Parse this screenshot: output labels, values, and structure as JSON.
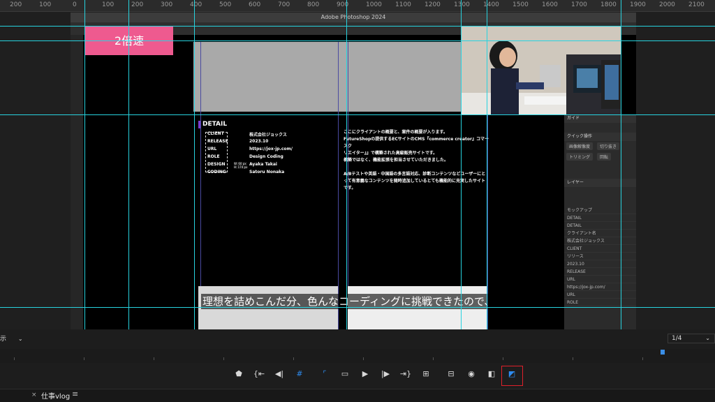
{
  "app": {
    "title": "Adobe Photoshop 2024"
  },
  "ruler": {
    "labels": [
      "200",
      "100",
      "0",
      "100",
      "200",
      "300",
      "400",
      "500",
      "600",
      "700",
      "800",
      "900",
      "1000",
      "1100",
      "1200",
      "1300",
      "1400",
      "1500",
      "1600",
      "1700",
      "1800",
      "1900",
      "2000",
      "2100"
    ]
  },
  "overlay": {
    "speed_label": "2倍速",
    "subtitle": "理想を詰めこんだ分、色んなコーディングに挑戦できたので、"
  },
  "detail": {
    "title": "DETAIL",
    "rows": [
      {
        "label": "CLIENT",
        "value": "株式会社ジョックス"
      },
      {
        "label": "RELEASE",
        "value": "2023.10"
      },
      {
        "label": "URL",
        "value": "https://jox-jp.com/"
      },
      {
        "label": "ROLE",
        "value": "Design Coding"
      },
      {
        "label": "DESIGN",
        "value": "Ayaka Takai"
      },
      {
        "label": "CODING",
        "value": "Satoru Nonaka"
      }
    ],
    "dim_w": "W: 60 px",
    "dim_h": "H: 174 px",
    "description": [
      "ここにクライアントの概要と、案件の概要が入ります。",
      "FutureShopの提供するECサイトのCMS『commerce creator』コマースク",
      "リエイター』』で構築された高級販売サイトです。",
      "構築ではなく、機能拡張を担当させていただきました。",
      "",
      "A/Bテストや英語・中国語の多言語対応、診断コンテンツなどユーザーにと",
      "って有意義なコンテンツを随時追加しているとても機能的に充実したサイト",
      "です。"
    ]
  },
  "ps_panel": {
    "guide_header": "ガイド",
    "quick_header": "クイック操作",
    "quick_buttons": [
      "画像解像度",
      "切り抜き",
      "トリミング",
      "回転"
    ],
    "layers_header": "レイヤー",
    "layers": [
      "モックアップ",
      "DETAIL",
      "DETAIL",
      "クライアント名",
      "株式会社ジョックス",
      "CLIENT",
      "リリース",
      "2023.10",
      "RELEASE",
      "URL",
      "https://jox-jp.com/",
      "URL",
      "ROLE"
    ]
  },
  "player": {
    "view_label": "示",
    "zoom": "1/4",
    "sequence_title": "仕事vlog",
    "menu_icon": "≡"
  },
  "controls": [
    {
      "name": "add-marker-icon",
      "glyph": "⬟"
    },
    {
      "name": "mark-in-icon",
      "glyph": "{⇤"
    },
    {
      "name": "step-back-icon",
      "glyph": "◀|"
    },
    {
      "name": "guides-icon",
      "glyph": "#"
    },
    {
      "name": "safe-margin-icon",
      "glyph": "⌜"
    },
    {
      "name": "frame-icon",
      "glyph": "▭"
    },
    {
      "name": "play-icon",
      "glyph": "▶"
    },
    {
      "name": "step-forward-icon",
      "glyph": "|▶"
    },
    {
      "name": "mark-out-icon",
      "glyph": "⇥}"
    },
    {
      "name": "insert-icon",
      "glyph": "⊞"
    },
    {
      "name": "overwrite-icon",
      "glyph": "⊟"
    },
    {
      "name": "export-frame-icon",
      "glyph": "◉"
    },
    {
      "name": "compare-icon",
      "glyph": "◧"
    },
    {
      "name": "proxy-toggle-icon",
      "glyph": "◩"
    }
  ],
  "colors": {
    "guide": "#27d3df",
    "speed_badge": "#ee5a8f",
    "highlight": "#e0202a",
    "active": "#2e8cf0"
  }
}
